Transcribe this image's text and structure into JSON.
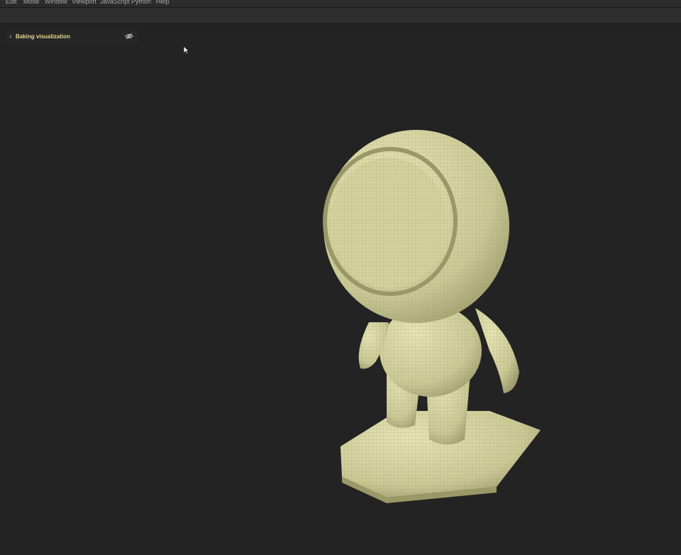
{
  "menu": {
    "items": [
      "Edit",
      "Mode",
      "Window",
      "Viewport",
      "JavaScript",
      "Python",
      "Help"
    ]
  },
  "panel": {
    "label": "Baking visualization",
    "visibility_icon": "eye-hidden-icon"
  },
  "colors": {
    "background": "#232323",
    "accent_label": "#e6d68d",
    "mesh": "#d8d6a0"
  }
}
